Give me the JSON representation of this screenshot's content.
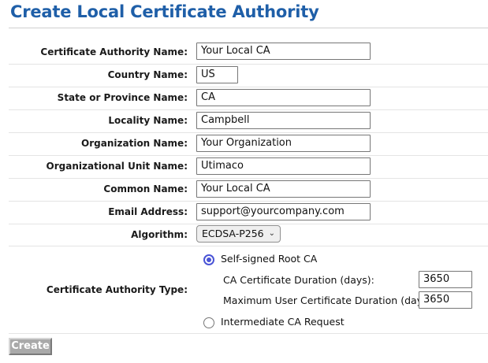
{
  "page": {
    "title": "Create Local Certificate Authority"
  },
  "form": {
    "fields": [
      {
        "label": "Certificate Authority Name:",
        "value": "Your Local CA"
      },
      {
        "label": "Country Name:",
        "value": "US"
      },
      {
        "label": "State or Province Name:",
        "value": "CA"
      },
      {
        "label": "Locality Name:",
        "value": "Campbell"
      },
      {
        "label": "Organization Name:",
        "value": "Your Organization"
      },
      {
        "label": "Organizational Unit Name:",
        "value": "Utimaco"
      },
      {
        "label": "Common Name:",
        "value": "Your Local CA"
      },
      {
        "label": "Email Address:",
        "value": "support@yourcompany.com"
      }
    ],
    "algorithm": {
      "label": "Algorithm:",
      "selected": "ECDSA-P256"
    },
    "ca_type": {
      "label": "Certificate Authority Type:",
      "options": [
        {
          "label": "Self-signed Root CA",
          "selected": true
        },
        {
          "label": "Intermediate CA Request",
          "selected": false
        }
      ],
      "ca_duration": {
        "label": "CA Certificate Duration (days):",
        "value": "3650"
      },
      "max_user_duration": {
        "label": "Maximum User Certificate Duration (days):",
        "value": "3650"
      }
    },
    "create_label": "Create"
  },
  "colors": {
    "title": "#1f5fa8",
    "radio_accent": "#4a54d6",
    "button_disabled": "#a9a9a9"
  }
}
